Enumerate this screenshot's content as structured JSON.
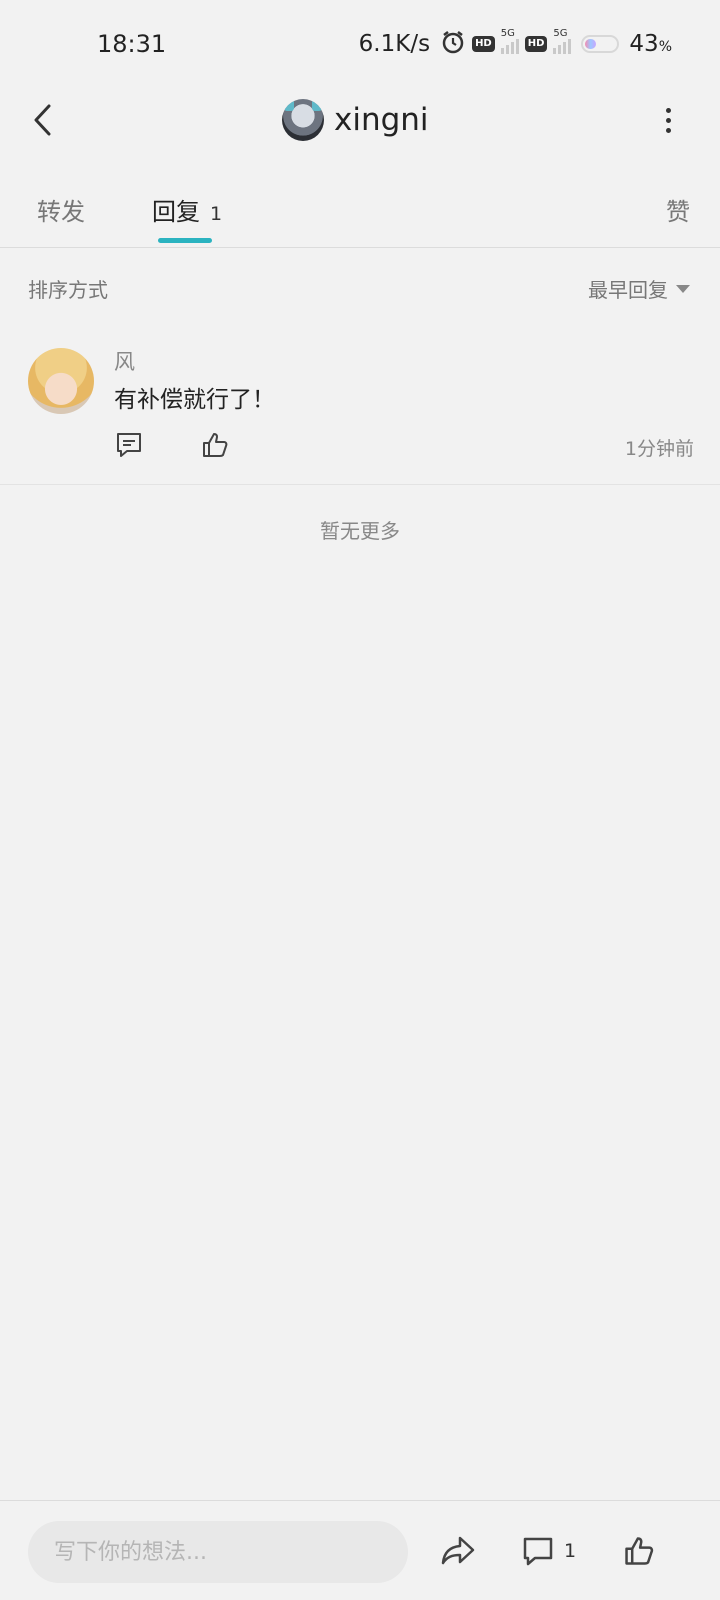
{
  "status_bar": {
    "time": "18:31",
    "net_speed": "6.1K/s",
    "hd1": "HD",
    "sig1": "5G",
    "hd2": "HD",
    "sig2": "5G",
    "battery_value": "43",
    "battery_unit": "%",
    "battery_level": 0.43
  },
  "header": {
    "username": "xingni"
  },
  "tabs": {
    "forward": "转发",
    "reply": "回复",
    "reply_count": "1",
    "like": "赞"
  },
  "sort": {
    "label": "排序方式",
    "selected": "最早回复"
  },
  "comments": [
    {
      "author": "风",
      "text": "有补偿就行了！",
      "time": "1分钟前"
    }
  ],
  "no_more": "暂无更多",
  "bottom_bar": {
    "input_placeholder": "写下你的想法...",
    "comment_count": "1"
  },
  "colors": {
    "accent": "#2bb3c0",
    "background": "#f2f2f2"
  }
}
